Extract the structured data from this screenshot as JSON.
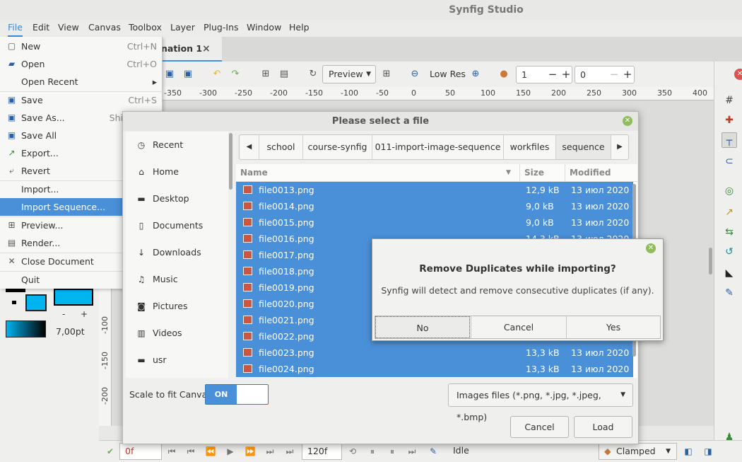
{
  "app": {
    "title": "Synfig Studio"
  },
  "menubar": [
    "File",
    "Edit",
    "View",
    "Canvas",
    "Toolbox",
    "Layer",
    "Plug-Ins",
    "Window",
    "Help"
  ],
  "doc_tab": {
    "label": "nation 1",
    "close": "×"
  },
  "toolbar": {
    "preview_label": "Preview",
    "quality_label": "Low Res",
    "spin1": {
      "value": "1",
      "minus": "−",
      "plus": "+"
    },
    "spin2": {
      "value": "0",
      "minus": "−",
      "plus": "+"
    }
  },
  "ruler": {
    "h_ticks": [
      "-350",
      "-300",
      "-250",
      "-200",
      "-150",
      "-100",
      "-50",
      "0",
      "50",
      "100",
      "150",
      "200",
      "250",
      "300",
      "350",
      "400"
    ],
    "v_ticks": [
      "-100",
      "-150",
      "-200"
    ]
  },
  "file_menu": {
    "items": [
      {
        "label": "New",
        "shortcut": "Ctrl+N",
        "icon": "new-file-icon"
      },
      {
        "label": "Open",
        "shortcut": "Ctrl+O",
        "icon": "folder-open-icon"
      },
      {
        "label": "Open Recent",
        "shortcut": "",
        "icon": "",
        "submenu": "▸"
      },
      {
        "label": "Save",
        "shortcut": "Ctrl+S",
        "icon": "save-icon"
      },
      {
        "label": "Save As...",
        "shortcut": "Shi",
        "icon": "save-as-icon"
      },
      {
        "label": "Save All",
        "shortcut": "",
        "icon": "save-all-icon"
      },
      {
        "label": "Export...",
        "shortcut": "",
        "icon": "export-icon"
      },
      {
        "label": "Revert",
        "shortcut": "",
        "icon": "revert-icon"
      },
      {
        "label": "Import...",
        "shortcut": "",
        "icon": ""
      },
      {
        "label": "Import Sequence...",
        "shortcut": "",
        "icon": ""
      },
      {
        "label": "Preview...",
        "shortcut": "",
        "icon": "preview-icon"
      },
      {
        "label": "Render...",
        "shortcut": "",
        "icon": "render-icon"
      },
      {
        "label": "Close Document",
        "shortcut": "",
        "icon": "close-icon"
      },
      {
        "label": "Quit",
        "shortcut": "",
        "icon": ""
      }
    ]
  },
  "left_panel": {
    "minus": "-",
    "plus": "+",
    "width_value": "7,00pt"
  },
  "file_dialog": {
    "title": "Please select a file",
    "places": [
      "Recent",
      "Home",
      "Desktop",
      "Documents",
      "Downloads",
      "Music",
      "Pictures",
      "Videos",
      "usr"
    ],
    "path": [
      "school",
      "course-synfig",
      "011-import-image-sequence",
      "workfiles",
      "sequence"
    ],
    "columns": {
      "name": "Name",
      "size": "Size",
      "modified": "Modified"
    },
    "files": [
      {
        "name": "file0013.png",
        "size": "12,9 kB",
        "modified": "13 июл 2020"
      },
      {
        "name": "file0014.png",
        "size": "9,0 kB",
        "modified": "13 июл 2020"
      },
      {
        "name": "file0015.png",
        "size": "9,0 kB",
        "modified": "13 июл 2020"
      },
      {
        "name": "file0016.png",
        "size": "14,3 kB",
        "modified": "13 июл 2020"
      },
      {
        "name": "file0017.png",
        "size": "",
        "modified": ""
      },
      {
        "name": "file0018.png",
        "size": "",
        "modified": ""
      },
      {
        "name": "file0019.png",
        "size": "",
        "modified": ""
      },
      {
        "name": "file0020.png",
        "size": "",
        "modified": ""
      },
      {
        "name": "file0021.png",
        "size": "",
        "modified": ""
      },
      {
        "name": "file0022.png",
        "size": "",
        "modified": ""
      },
      {
        "name": "file0023.png",
        "size": "13,3 kB",
        "modified": "13 июл 2020"
      },
      {
        "name": "file0024.png",
        "size": "13,3 kB",
        "modified": "13 июл 2020"
      }
    ],
    "scale_label": "Scale to fit Canvas",
    "scale_toggle": "ON",
    "filter": "Images files (*.png, *.jpg, *.jpeg, *.bmp)",
    "cancel": "Cancel",
    "load": "Load"
  },
  "dup_dialog": {
    "heading": "Remove Duplicates while importing?",
    "message": "Synfig will detect and remove consecutive duplicates (if any).",
    "no": "No",
    "cancel": "Cancel",
    "yes": "Yes"
  },
  "statusbar": {
    "start_time": "0f",
    "end_time": "120f",
    "status": "Idle",
    "interpolation": "Clamped"
  },
  "colors": {
    "accent": "#4a90d9",
    "fill_color": "#00b4f0",
    "close_green": "#8fbc5c"
  }
}
